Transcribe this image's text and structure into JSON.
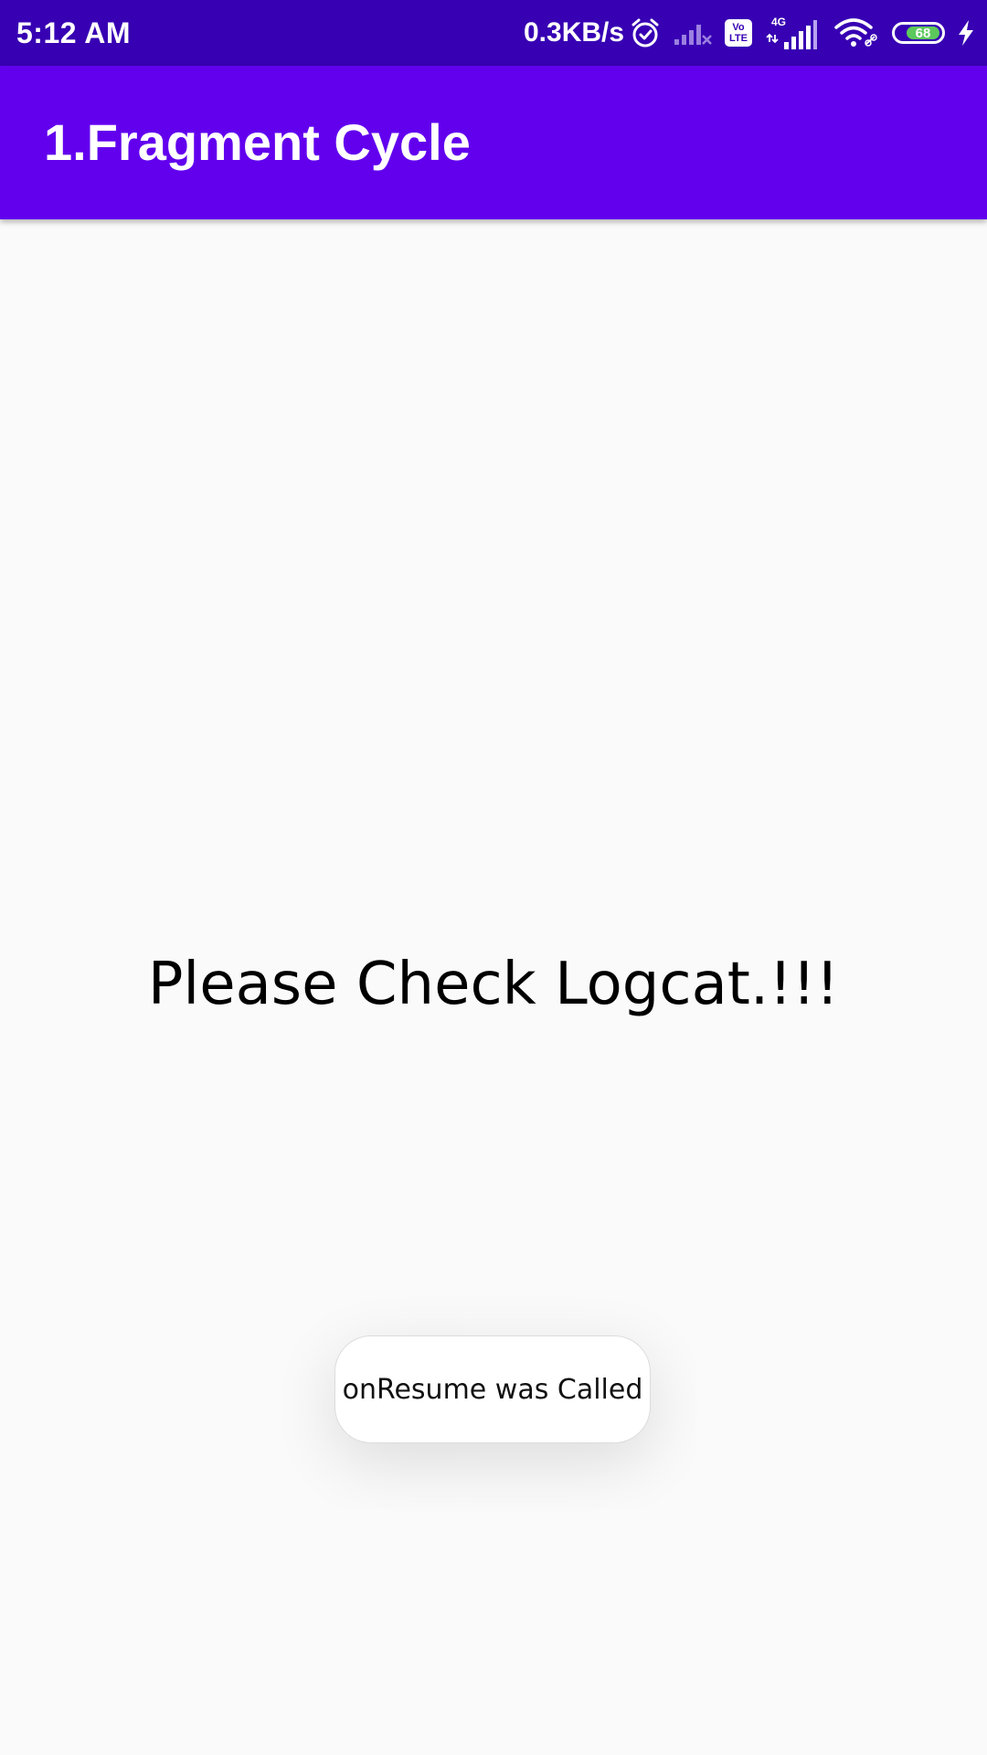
{
  "status_bar": {
    "time": "5:12 AM",
    "network_speed": "0.3KB/s",
    "volte_line1": "Vo",
    "volte_line2": "LTE",
    "network_type": "4G",
    "battery_level": "68",
    "icons": [
      "alarm-icon",
      "signal-off-icon",
      "volte-icon",
      "signal-4g-icon",
      "wifi-icon",
      "battery-icon",
      "charging-icon"
    ]
  },
  "app_bar": {
    "title": "1.Fragment Cycle",
    "color": "#6200ee"
  },
  "main": {
    "message": "Please Check Logcat.!!!"
  },
  "toast": {
    "text": "onResume was Called"
  },
  "colors": {
    "status_bar": "#3700b3",
    "primary": "#6200ee",
    "background": "#fafafa"
  }
}
